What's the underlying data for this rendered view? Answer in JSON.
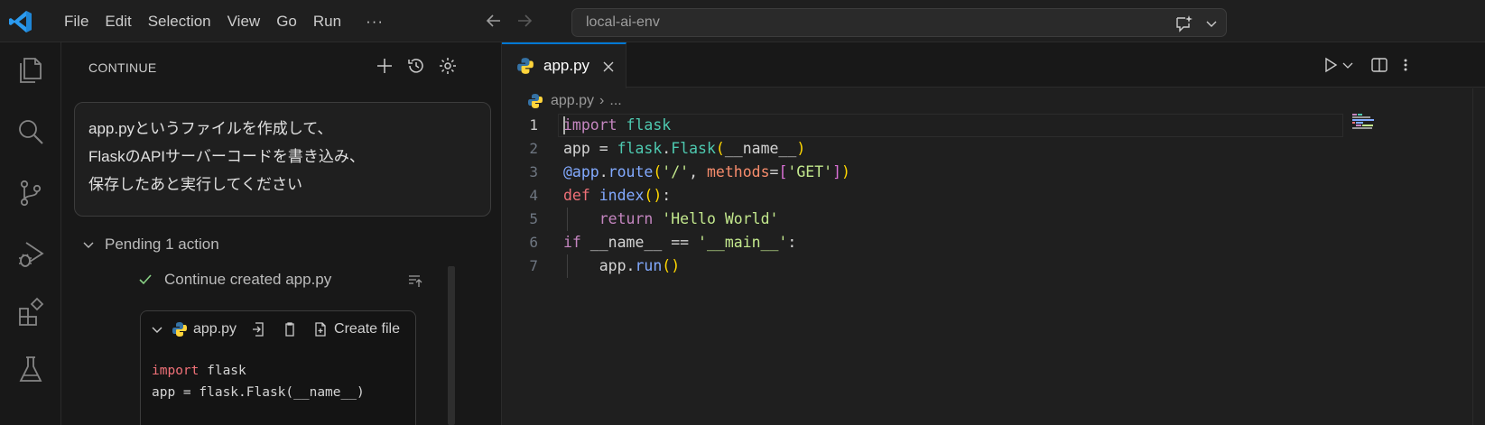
{
  "titlebar": {
    "menu": [
      "File",
      "Edit",
      "Selection",
      "View",
      "Go",
      "Run"
    ],
    "menu_more": "···",
    "search_text": "local-ai-env"
  },
  "activity_bar": {
    "icons": [
      "files-icon",
      "search-icon",
      "source-control-icon",
      "run-debug-icon",
      "extensions-icon",
      "testing-icon"
    ]
  },
  "sidebar": {
    "title": "CONTINUE",
    "prompt_lines": [
      "app.pyというファイルを作成して、",
      "FlaskのAPIサーバーコードを書き込み、",
      "保存したあと実行してください"
    ],
    "pending_label": "Pending 1 action",
    "created_label": "Continue created app.py",
    "codeblock": {
      "filename": "app.py",
      "create_label": "Create file",
      "lines": [
        "import flask",
        "app = flask.Flask(__name__)"
      ]
    }
  },
  "editor": {
    "tab_label": "app.py",
    "breadcrumb_file": "app.py",
    "breadcrumb_more": "...",
    "line_numbers": [
      "1",
      "2",
      "3",
      "4",
      "5",
      "6",
      "7"
    ]
  },
  "colors": {
    "accent": "#0078d4",
    "check_green": "#89d185",
    "python_blue": "#3572a5",
    "python_yellow": "#ffd43b"
  }
}
